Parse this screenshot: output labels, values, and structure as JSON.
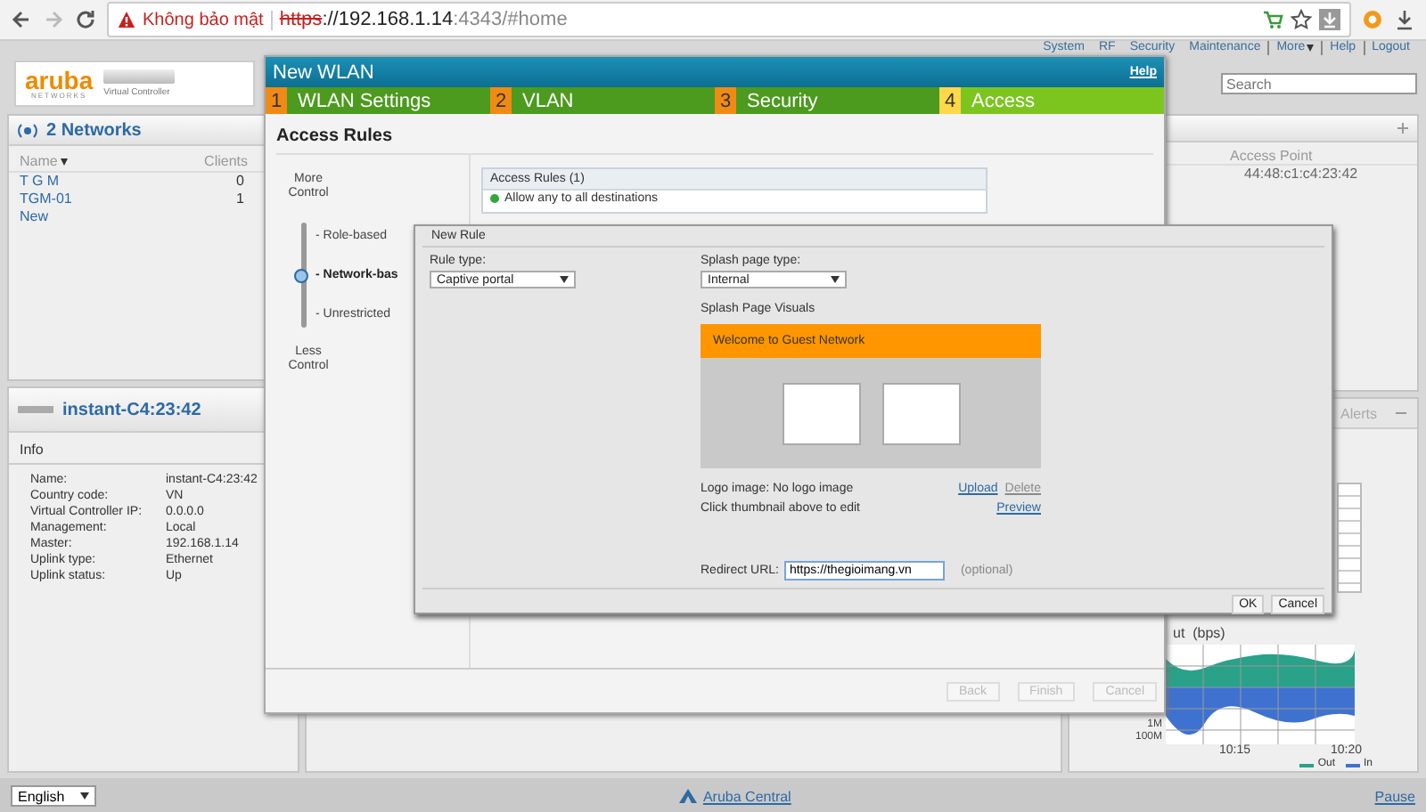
{
  "browser": {
    "security_label": "Không bảo mật",
    "url_scheme": "https",
    "url_host": "://192.168.1.14",
    "url_rest": ":4343/#home"
  },
  "header": {
    "logo": "aruba",
    "logo_subtitle": "NETWORKS",
    "controller_label": "Virtual Controller",
    "search_placeholder": "Search",
    "nav": [
      {
        "label": "System",
        "kind": "link"
      },
      {
        "label": "RF",
        "kind": "link"
      },
      {
        "label": "Security",
        "kind": "link"
      },
      {
        "label": "Maintenance",
        "kind": "link"
      },
      {
        "label": "More",
        "kind": "menu"
      },
      {
        "label": "Help",
        "kind": "link"
      },
      {
        "label": "Logout",
        "kind": "link"
      }
    ]
  },
  "networks_panel": {
    "title": "2 Networks",
    "columns": [
      "Name",
      "Clients"
    ],
    "rows": [
      {
        "name": "T G M",
        "clients": "0"
      },
      {
        "name": "TGM-01",
        "clients": "1"
      }
    ],
    "new_link": "New"
  },
  "ap_panel": {
    "title": "instant-C4:23:42",
    "section": "Info",
    "fields": [
      {
        "label": "Name:",
        "value": "instant-C4:23:42"
      },
      {
        "label": "Country code:",
        "value": "VN"
      },
      {
        "label": "Virtual Controller IP:",
        "value": "0.0.0.0"
      },
      {
        "label": "Management:",
        "value": "Local"
      },
      {
        "label": "Master:",
        "value": "192.168.1.14"
      },
      {
        "label": "Uplink type:",
        "value": "Ethernet"
      },
      {
        "label": "Uplink status:",
        "value": "Up"
      }
    ]
  },
  "access_point_panel": {
    "column": "Access Point",
    "value": "44:48:c1:c4:23:42"
  },
  "alerts_panel": {
    "title": "Alerts",
    "chart_title": "ut  (bps)",
    "y_labels": [
      "1M",
      "100M"
    ],
    "x_labels": [
      "10:15",
      "10:20"
    ],
    "legend": [
      {
        "label": "Out",
        "color": "#2aa189"
      },
      {
        "label": "In",
        "color": "#3f72d0"
      }
    ]
  },
  "wlan_dialog": {
    "title": "New WLAN",
    "help": "Help",
    "steps": [
      {
        "number": "1",
        "label": "WLAN Settings",
        "selected": false
      },
      {
        "number": "2",
        "label": "VLAN",
        "selected": false
      },
      {
        "number": "3",
        "label": "Security",
        "selected": false
      },
      {
        "number": "4",
        "label": "Access",
        "selected": true
      }
    ],
    "heading": "Access Rules",
    "more_label": "More Control",
    "less_label": "Less Control",
    "options": [
      {
        "label": "- Role-based",
        "selected": false
      },
      {
        "label": "- Network-bas",
        "selected": true
      },
      {
        "label": "- Unrestricted",
        "selected": false
      }
    ],
    "rules_title": "Access Rules (1)",
    "rules": [
      "Allow any to all destinations"
    ],
    "buttons": [
      {
        "label": "Back",
        "disabled": true
      },
      {
        "label": "Finish",
        "disabled": true
      },
      {
        "label": "Cancel",
        "disabled": true
      }
    ]
  },
  "rule_dialog": {
    "title": "New Rule",
    "rule_type_label": "Rule type:",
    "rule_type_value": "Captive portal",
    "splash_type_label": "Splash page type:",
    "splash_type_value": "Internal",
    "visuals_label": "Splash Page Visuals",
    "banner": "Welcome to Guest Network",
    "logo_label": "Logo image:",
    "logo_value": "No logo image",
    "links": [
      {
        "label": "Upload",
        "disabled": false
      },
      {
        "label": "Delete",
        "disabled": true
      }
    ],
    "hint": "Click thumbnail above to edit",
    "preview": "Preview",
    "redirect_label": "Redirect URL:",
    "redirect_value": "https://thegioimang.vn",
    "redirect_hint": "(optional)",
    "buttons": [
      {
        "label": "OK",
        "disabled": false
      },
      {
        "label": "Cancel",
        "disabled": false
      }
    ]
  },
  "footer": {
    "language": "English",
    "central_link": "Aruba Central",
    "pause": "Pause"
  }
}
